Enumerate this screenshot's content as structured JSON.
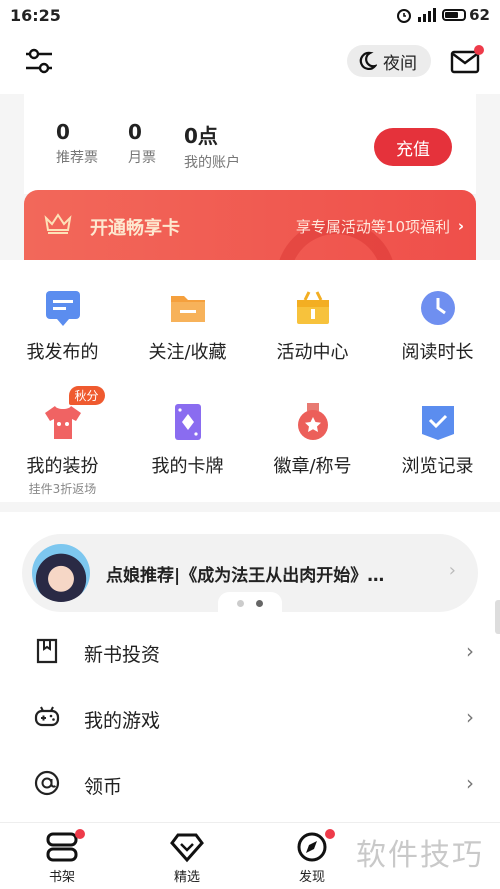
{
  "status_bar": {
    "time": "16:25",
    "battery": "62"
  },
  "header": {
    "night_mode_label": "夜间"
  },
  "account": {
    "stats": [
      {
        "value": "0",
        "label": "推荐票"
      },
      {
        "value": "0",
        "label": "月票"
      },
      {
        "value": "0点",
        "label": "我的账户"
      }
    ],
    "recharge_label": "充值"
  },
  "vip_banner": {
    "title": "开通畅享卡",
    "promo": "享专属活动等10项福利"
  },
  "grid": {
    "items": [
      {
        "label": "我发布的",
        "icon": "post-icon"
      },
      {
        "label": "关注/收藏",
        "icon": "folder-icon"
      },
      {
        "label": "活动中心",
        "icon": "gift-icon"
      },
      {
        "label": "阅读时长",
        "icon": "clock-icon"
      },
      {
        "label": "我的装扮",
        "icon": "tshirt-icon",
        "badge": "秋分",
        "sub": "挂件3折返场"
      },
      {
        "label": "我的卡牌",
        "icon": "card-icon"
      },
      {
        "label": "徽章/称号",
        "icon": "medal-icon"
      },
      {
        "label": "浏览记录",
        "icon": "history-icon"
      }
    ]
  },
  "recommendation": {
    "text": "点娘推荐|《成为法王从出肉开始》…"
  },
  "list": [
    {
      "label": "新书投资",
      "icon": "book-icon"
    },
    {
      "label": "我的游戏",
      "icon": "gamepad-icon"
    },
    {
      "label": "领币",
      "icon": "at-coin-icon"
    }
  ],
  "bottom_nav": [
    {
      "label": "书架",
      "icon": "bookshelf-icon"
    },
    {
      "label": "精选",
      "icon": "diamond-icon"
    },
    {
      "label": "发现",
      "icon": "compass-icon"
    }
  ],
  "watermark": "软件技巧",
  "colors": {
    "accent": "#e5323b",
    "banner_start": "#f2685a",
    "banner_end": "#ef4f4a"
  }
}
